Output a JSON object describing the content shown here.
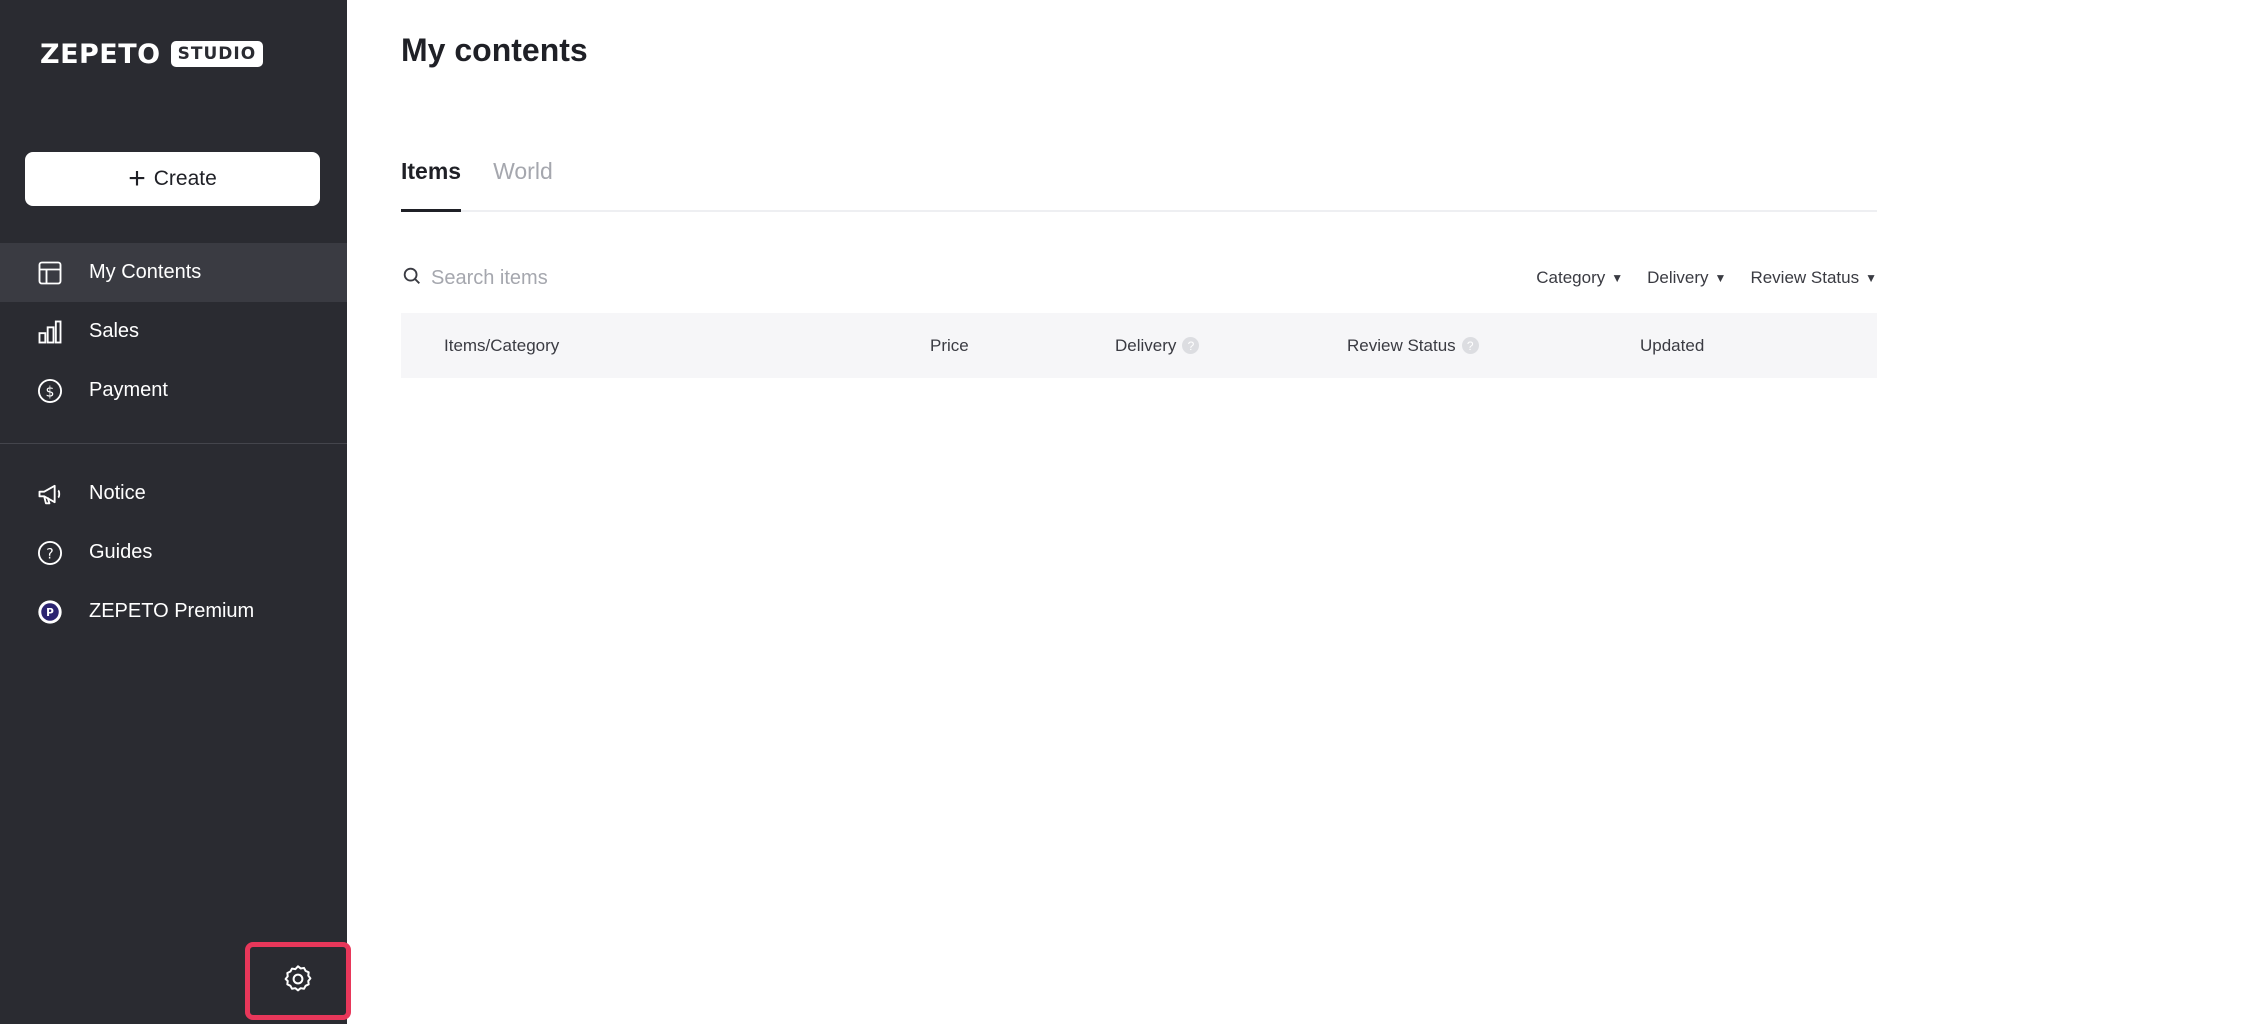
{
  "brand": {
    "name": "ZEPETO",
    "badge": "STUDIO"
  },
  "sidebar": {
    "create_label": "Create",
    "items": [
      {
        "label": "My Contents",
        "icon": "layout-icon",
        "active": true
      },
      {
        "label": "Sales",
        "icon": "bar-chart-icon",
        "active": false
      },
      {
        "label": "Payment",
        "icon": "dollar-circle-icon",
        "active": false
      }
    ],
    "items2": [
      {
        "label": "Notice",
        "icon": "megaphone-icon"
      },
      {
        "label": "Guides",
        "icon": "question-circle-icon"
      },
      {
        "label": "ZEPETO Premium",
        "icon": "premium-p-icon"
      }
    ],
    "settings_icon": "gear-icon"
  },
  "main": {
    "title": "My contents",
    "tabs": [
      {
        "label": "Items",
        "active": true
      },
      {
        "label": "World",
        "active": false
      }
    ],
    "search": {
      "placeholder": "Search items"
    },
    "filters": [
      {
        "label": "Category"
      },
      {
        "label": "Delivery"
      },
      {
        "label": "Review Status"
      }
    ],
    "table": {
      "columns": [
        {
          "label": "Items/Category"
        },
        {
          "label": "Price"
        },
        {
          "label": "Delivery"
        },
        {
          "label": "Review Status"
        },
        {
          "label": "Updated"
        }
      ]
    }
  },
  "colors": {
    "sidebar_bg": "#2a2b31",
    "highlight": "#e8375a"
  }
}
